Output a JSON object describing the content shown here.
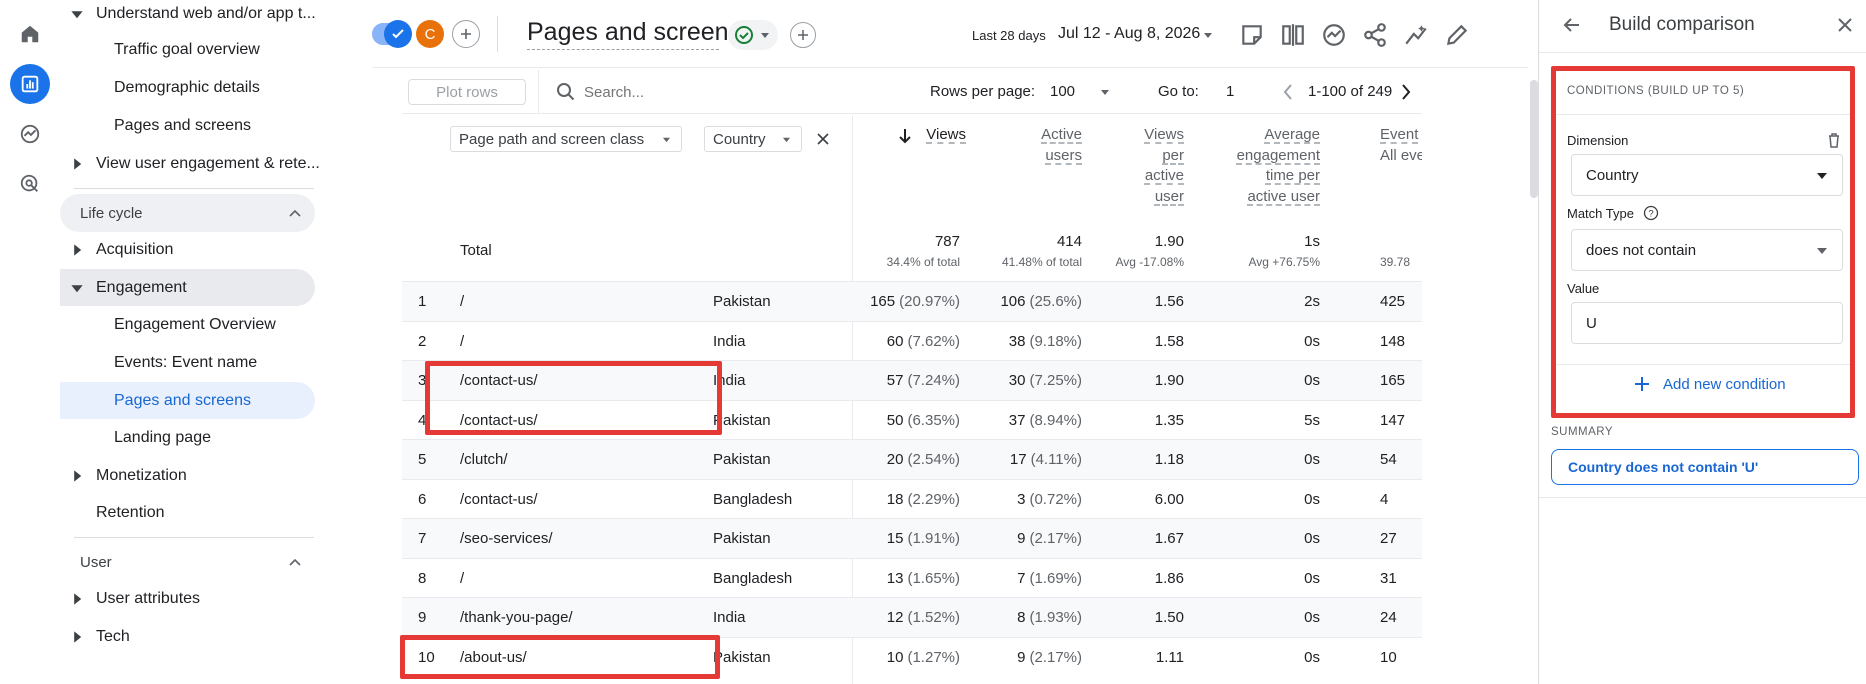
{
  "nav": {
    "items": [
      {
        "label": "Understand web and/or app t...",
        "expanded": true
      },
      {
        "label": "Traffic goal overview"
      },
      {
        "label": "Demographic details"
      },
      {
        "label": "Pages and screens"
      },
      {
        "label": "View user engagement & rete..."
      }
    ],
    "lifecycle": {
      "label": "Life cycle",
      "items": [
        "Acquisition",
        "Engagement",
        "Engagement Overview",
        "Events: Event name",
        "Pages and screens",
        "Landing page",
        "Monetization",
        "Retention"
      ]
    },
    "user": {
      "label": "User",
      "items": [
        "User attributes",
        "Tech"
      ]
    }
  },
  "header": {
    "avatar_letter": "C",
    "title": "Pages and screens",
    "date_label": "Last 28 days",
    "date_range": "Jul 12 - Aug 8, 2026"
  },
  "toolbar": {
    "plot_rows": "Plot rows",
    "search_placeholder": "Search...",
    "rows_per_page_label": "Rows per page:",
    "rows_per_page": "100",
    "goto_label": "Go to:",
    "goto_value": "1",
    "pagination": "1-100 of 249"
  },
  "table": {
    "dim_chip_1": "Page path and screen class",
    "dim_chip_2": "Country",
    "columns": [
      {
        "lines": [
          "Views"
        ]
      },
      {
        "lines": [
          "Active",
          "users"
        ]
      },
      {
        "lines": [
          "Views",
          "per",
          "active",
          "user"
        ]
      },
      {
        "lines": [
          "Average",
          "engagement",
          "time per",
          "active user"
        ]
      },
      {
        "lines": [
          "Event",
          "All eve"
        ]
      }
    ],
    "total": {
      "label": "Total",
      "values": [
        "787",
        "414",
        "1.90",
        "1s"
      ],
      "subs": [
        "34.4% of total",
        "41.48% of total",
        "Avg -17.08%",
        "Avg +76.75%",
        "39.78"
      ]
    },
    "rows": [
      {
        "n": "1",
        "path": "/",
        "country": "Pakistan",
        "views": "165",
        "views_pct": "(20.97%)",
        "users": "106",
        "users_pct": "(25.6%)",
        "vpu": "1.56",
        "time": "2s",
        "events": "425"
      },
      {
        "n": "2",
        "path": "/",
        "country": "India",
        "views": "60",
        "views_pct": "(7.62%)",
        "users": "38",
        "users_pct": "(9.18%)",
        "vpu": "1.58",
        "time": "0s",
        "events": "148"
      },
      {
        "n": "3",
        "path": "/contact-us/",
        "country": "India",
        "views": "57",
        "views_pct": "(7.24%)",
        "users": "30",
        "users_pct": "(7.25%)",
        "vpu": "1.90",
        "time": "0s",
        "events": "165"
      },
      {
        "n": "4",
        "path": "/contact-us/",
        "country": "Pakistan",
        "views": "50",
        "views_pct": "(6.35%)",
        "users": "37",
        "users_pct": "(8.94%)",
        "vpu": "1.35",
        "time": "5s",
        "events": "147"
      },
      {
        "n": "5",
        "path": "/clutch/",
        "country": "Pakistan",
        "views": "20",
        "views_pct": "(2.54%)",
        "users": "17",
        "users_pct": "(4.11%)",
        "vpu": "1.18",
        "time": "0s",
        "events": "54"
      },
      {
        "n": "6",
        "path": "/contact-us/",
        "country": "Bangladesh",
        "views": "18",
        "views_pct": "(2.29%)",
        "users": "3",
        "users_pct": "(0.72%)",
        "vpu": "6.00",
        "time": "0s",
        "events": "4"
      },
      {
        "n": "7",
        "path": "/seo-services/",
        "country": "Pakistan",
        "views": "15",
        "views_pct": "(1.91%)",
        "users": "9",
        "users_pct": "(2.17%)",
        "vpu": "1.67",
        "time": "0s",
        "events": "27"
      },
      {
        "n": "8",
        "path": "/",
        "country": "Bangladesh",
        "views": "13",
        "views_pct": "(1.65%)",
        "users": "7",
        "users_pct": "(1.69%)",
        "vpu": "1.86",
        "time": "0s",
        "events": "31"
      },
      {
        "n": "9",
        "path": "/thank-you-page/",
        "country": "India",
        "views": "12",
        "views_pct": "(1.52%)",
        "users": "8",
        "users_pct": "(1.93%)",
        "vpu": "1.50",
        "time": "0s",
        "events": "24"
      },
      {
        "n": "10",
        "path": "/about-us/",
        "country": "Pakistan",
        "views": "10",
        "views_pct": "(1.27%)",
        "users": "9",
        "users_pct": "(2.17%)",
        "vpu": "1.11",
        "time": "0s",
        "events": "10"
      }
    ]
  },
  "panel": {
    "title": "Build comparison",
    "conditions_label": "CONDITIONS (BUILD UP TO 5)",
    "dimension_label": "Dimension",
    "dimension_value": "Country",
    "match_type_label": "Match Type",
    "match_type_value": "does not contain",
    "value_label": "Value",
    "value_input": "U",
    "add_condition": "Add new condition",
    "summary_label": "SUMMARY",
    "summary_text": "Country does not contain 'U'"
  },
  "colors": {
    "accent": "#1a73e8",
    "highlight": "#e53935",
    "avatar": "#e8710a"
  }
}
